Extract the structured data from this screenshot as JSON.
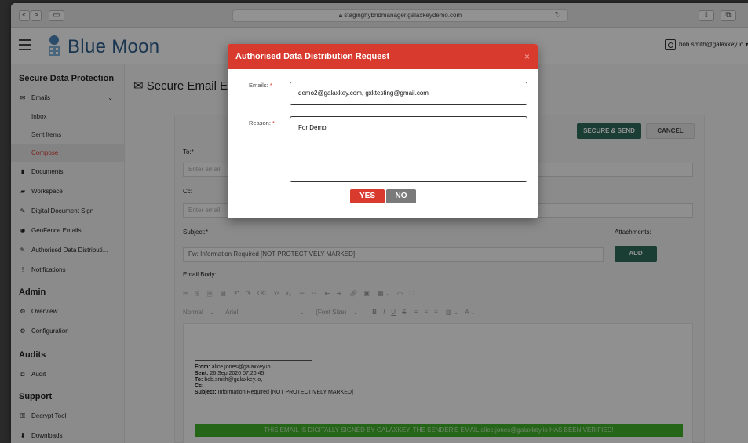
{
  "browser": {
    "url": "staginghybridmanager.galaxkeydemo.com",
    "back": "<",
    "forward": ">"
  },
  "header": {
    "logo_text": "Blue Moon",
    "user": "bob.smith@galaxkey.io ▾"
  },
  "sidebar": {
    "sections": {
      "secure": "Secure Data Protection",
      "admin": "Admin",
      "audits": "Audits",
      "support": "Support"
    },
    "items": {
      "emails": "Emails",
      "inbox": "Inbox",
      "sent": "Sent Items",
      "compose": "Compose",
      "documents": "Documents",
      "workspace": "Workspace",
      "digital_sign": "Digital Document Sign",
      "geofence": "GeoFence Emails",
      "authorised": "Authorised Data Distributi...",
      "notifications": "Notifications",
      "overview": "Overview",
      "configuration": "Configuration",
      "audit": "Audit",
      "decrypt": "Decrypt Tool",
      "downloads": "Downloads"
    }
  },
  "main": {
    "page_title": "Secure Email E",
    "secure_send": "SECURE & SEND",
    "cancel": "CANCEL",
    "to_label": "To:*",
    "to_placeholder": "Enter email",
    "cc_label": "Cc:",
    "cc_placeholder": "Enter email",
    "subject_label": "Subject:*",
    "subject_value": "Fw: Information Required [NOT PROTECTIVELY MARKED]",
    "attachments_label": "Attachments:",
    "add": "ADD",
    "body_label": "Email Body:",
    "format_normal": "Normal",
    "format_font": "Arial",
    "format_size": "(Font Size)",
    "quote_from_label": "From:",
    "quote_from": "alice.jones@galaxkey.io",
    "quote_sent_label": "Sent:",
    "quote_sent": "26 Sep 2020 07:26:45",
    "quote_to_label": "To:",
    "quote_to": "bob.smith@galaxkey.io,",
    "quote_cc_label": "Cc:",
    "quote_subject_label": "Subject:",
    "quote_subject": "Information Required [NOT PROTECTIVELY MARKED]",
    "banner": "THIS EMAIL IS DIGITALLY SIGNED BY GALAXKEY. THE SENDER'S EMAIL alice.jones@galaxkey.io HAS BEEN VERIFIED!"
  },
  "modal": {
    "title": "Authorised Data Distribution Request",
    "close": "×",
    "emails_label": "Emails:",
    "emails_value": "demo2@galaxkey.com, gxktesting@gmail.com",
    "reason_label": "Reason:",
    "reason_value": "For Demo",
    "required_mark": "*",
    "yes": "YES",
    "no": "NO"
  },
  "colors": {
    "accent_red": "#d83a2e",
    "accent_green": "#2e6b5a",
    "banner_green": "#3fae2a",
    "logo_blue": "#2b5c8a"
  }
}
